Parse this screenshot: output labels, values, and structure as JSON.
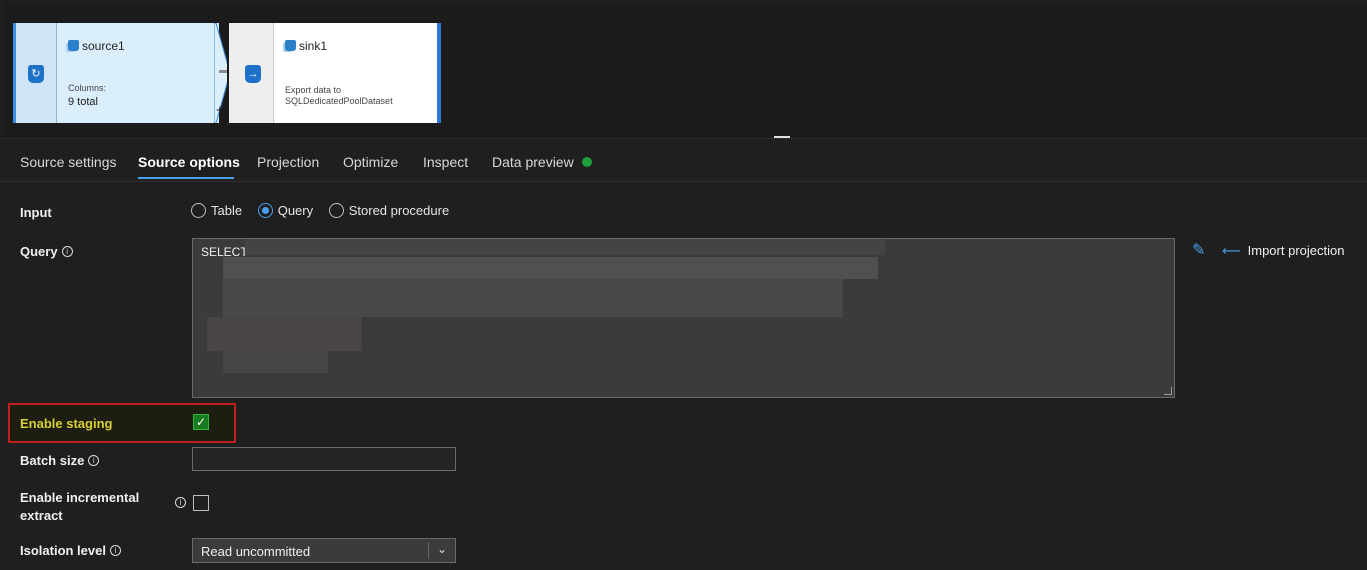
{
  "nodes": {
    "source": {
      "name": "source1",
      "sub_label": "Columns:",
      "value": "9 total"
    },
    "sink": {
      "name": "sink1",
      "desc_line1": "Export data to",
      "desc_line2": "SQLDedicatedPoolDataset"
    }
  },
  "tabs": [
    {
      "label": "Source settings",
      "active": false
    },
    {
      "label": "Source options",
      "active": true
    },
    {
      "label": "Projection",
      "active": false
    },
    {
      "label": "Optimize",
      "active": false
    },
    {
      "label": "Inspect",
      "active": false
    },
    {
      "label": "Data preview",
      "active": false
    }
  ],
  "form": {
    "input_label": "Input",
    "input_options": [
      "Table",
      "Query",
      "Stored procedure"
    ],
    "input_selected": "Query",
    "query_label": "Query",
    "query_text": "SELECT",
    "import_projection": "Import projection",
    "staging_label": "Enable staging",
    "staging_checked": true,
    "batch_label": "Batch size",
    "batch_value": "",
    "incremental_label_1": "Enable incremental",
    "incremental_label_2": "extract",
    "incremental_checked": false,
    "isolation_label": "Isolation level",
    "isolation_value": "Read uncommitted"
  },
  "colors": {
    "accent": "#4aa0f0",
    "status_green": "#1e9e3a",
    "highlight_border": "#c0211f",
    "highlight_text": "#d8cf36"
  },
  "icons": [
    "dataset-icon",
    "source-node-icon",
    "sink-node-icon",
    "info-icon",
    "pencil-icon",
    "import-arrow-icon",
    "chevron-down-icon",
    "check-icon"
  ]
}
